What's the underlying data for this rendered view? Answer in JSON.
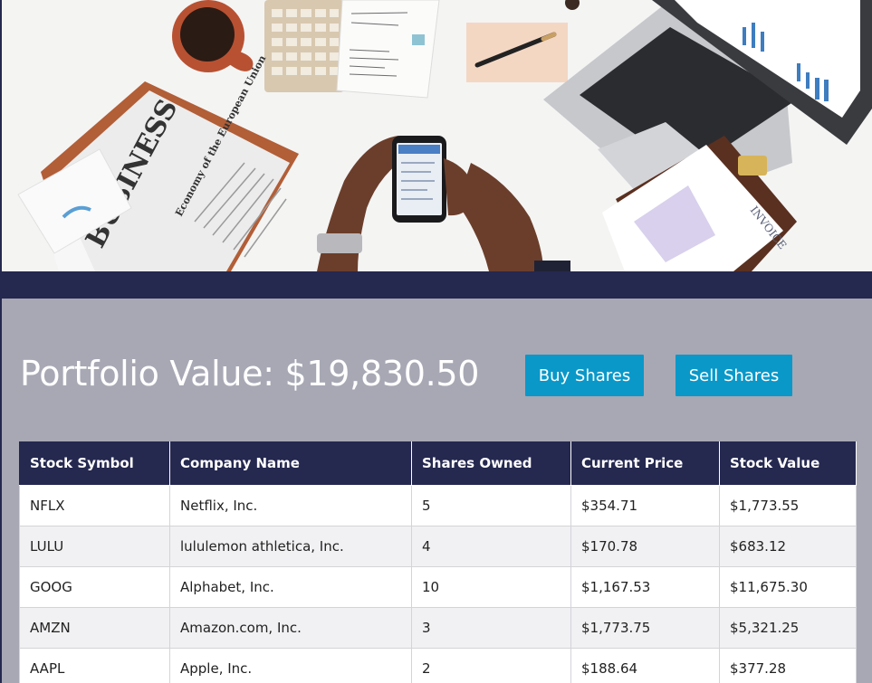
{
  "portfolio": {
    "title": "Portfolio Value: $19,830.50"
  },
  "actions": {
    "buy_label": "Buy Shares",
    "sell_label": "Sell Shares"
  },
  "hero": {
    "newspaper_headline": "BUSINESS",
    "newspaper_subhead": "Economy of the European Union",
    "invoice_text": "INVOICE"
  },
  "table": {
    "headers": [
      "Stock Symbol",
      "Company Name",
      "Shares Owned",
      "Current Price",
      "Stock Value"
    ],
    "rows": [
      {
        "symbol": "NFLX",
        "company": "Netflix, Inc.",
        "shares": "5",
        "price": "$354.71",
        "value": "$1,773.55"
      },
      {
        "symbol": "LULU",
        "company": "lululemon athletica, Inc.",
        "shares": "4",
        "price": "$170.78",
        "value": "$683.12"
      },
      {
        "symbol": "GOOG",
        "company": "Alphabet, Inc.",
        "shares": "10",
        "price": "$1,167.53",
        "value": "$11,675.30"
      },
      {
        "symbol": "AMZN",
        "company": "Amazon.com, Inc.",
        "shares": "3",
        "price": "$1,773.75",
        "value": "$5,321.25"
      },
      {
        "symbol": "AAPL",
        "company": "Apple, Inc.",
        "shares": "2",
        "price": "$188.64",
        "value": "$377.28"
      }
    ]
  },
  "colors": {
    "navy": "#25284f",
    "accent": "#0a98c9",
    "page_background": "#a7a8b4"
  }
}
